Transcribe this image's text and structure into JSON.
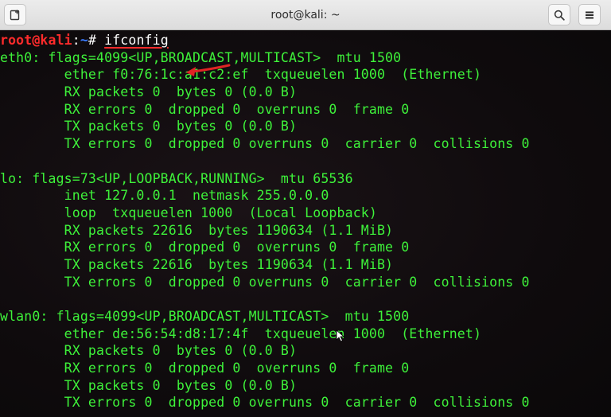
{
  "window": {
    "title": "root@kali: ~",
    "new_tab_icon": "new-tab-icon",
    "search_icon": "search-icon",
    "menu_icon": "hamburger-menu-icon"
  },
  "prompt": {
    "user_host": "root@kali",
    "separator": ":",
    "path": "~",
    "symbol": "#",
    "command": "ifconfig"
  },
  "interfaces": [
    {
      "header": "eth0: flags=4099<UP,BROADCAST,MULTICAST>  mtu 1500",
      "lines": [
        "        ether f0:76:1c:a1:c2:ef  txqueuelen 1000  (Ethernet)",
        "        RX packets 0  bytes 0 (0.0 B)",
        "        RX errors 0  dropped 0  overruns 0  frame 0",
        "        TX packets 0  bytes 0 (0.0 B)",
        "        TX errors 0  dropped 0 overruns 0  carrier 0  collisions 0"
      ]
    },
    {
      "header": "lo: flags=73<UP,LOOPBACK,RUNNING>  mtu 65536",
      "lines": [
        "        inet 127.0.0.1  netmask 255.0.0.0",
        "        loop  txqueuelen 1000  (Local Loopback)",
        "        RX packets 22616  bytes 1190634 (1.1 MiB)",
        "        RX errors 0  dropped 0  overruns 0  frame 0",
        "        TX packets 22616  bytes 1190634 (1.1 MiB)",
        "        TX errors 0  dropped 0 overruns 0  carrier 0  collisions 0"
      ]
    },
    {
      "header": "wlan0: flags=4099<UP,BROADCAST,MULTICAST>  mtu 1500",
      "lines": [
        "        ether de:56:54:d8:17:4f  txqueuelen 1000  (Ethernet)",
        "        RX packets 0  bytes 0 (0.0 B)",
        "        RX errors 0  dropped 0  overruns 0  frame 0",
        "        TX packets 0  bytes 0 (0.0 B)",
        "        TX errors 0  dropped 0 overruns 0  carrier 0  collisions 0"
      ]
    }
  ],
  "colors": {
    "terminal_text": "#3ef23a",
    "prompt_user": "#ff2b2b",
    "prompt_path": "#3a7bff",
    "annotation_arrow": "#e02424",
    "titlebar": "#e4e4e4",
    "terminal_bg": "#0f0b0d"
  }
}
